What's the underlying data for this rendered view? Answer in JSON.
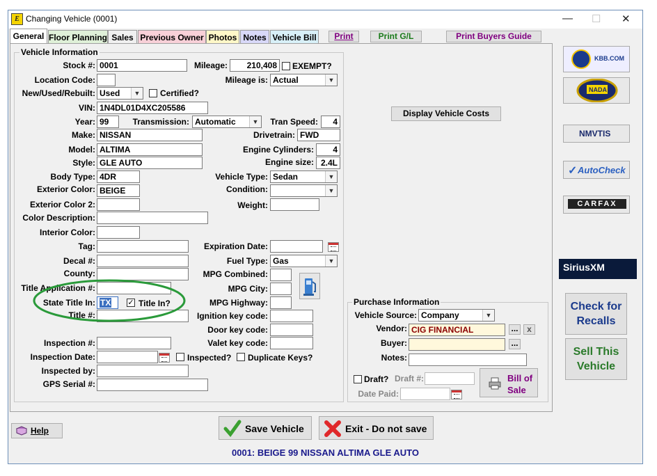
{
  "window": {
    "title": "Changing Vehicle  (0001)",
    "app_icon": "E"
  },
  "tabs": [
    {
      "label": "General",
      "color": "#ffffff"
    },
    {
      "label": "Floor Planning",
      "color": "#dff0d8"
    },
    {
      "label": "Sales",
      "color": "#f0f0f0"
    },
    {
      "label": "Previous Owner",
      "color": "#f8d0d8"
    },
    {
      "label": "Photos",
      "color": "#fff8c8"
    },
    {
      "label": "Notes",
      "color": "#d8d8f8"
    },
    {
      "label": "Vehicle Bill",
      "color": "#d8f0f8"
    }
  ],
  "print_buttons": {
    "print": "Print",
    "print_gl": "Print G/L",
    "print_buyers_guide": "Print Buyers Guide"
  },
  "vehicle_info": {
    "group_title": "Vehicle Information",
    "stock_label": "Stock #:",
    "stock": "0001",
    "mileage_label": "Mileage:",
    "mileage": "210,408",
    "exempt_label": "EXEMPT?",
    "location_label": "Location Code:",
    "location": "",
    "mileage_is_label": "Mileage is:",
    "mileage_is": "Actual",
    "new_used_label": "New/Used/Rebuilt:",
    "new_used": "Used",
    "certified_label": "Certified?",
    "vin_label": "VIN:",
    "vin": "1N4DL01D4XC205586",
    "year_label": "Year:",
    "year": "99",
    "transmission_label": "Transmission:",
    "transmission": "Automatic",
    "tran_speed_label": "Tran Speed:",
    "tran_speed": "4",
    "make_label": "Make:",
    "make": "NISSAN",
    "drivetrain_label": "Drivetrain:",
    "drivetrain": "FWD",
    "model_label": "Model:",
    "model": "ALTIMA",
    "cylinders_label": "Engine Cylinders:",
    "cylinders": "4",
    "style_label": "Style:",
    "style": "GLE AUTO",
    "engine_size_label": "Engine size:",
    "engine_size": "2.4L",
    "body_type_label": "Body Type:",
    "body_type": "4DR",
    "vehicle_type_label": "Vehicle Type:",
    "vehicle_type": "Sedan",
    "ext_color_label": "Exterior Color:",
    "ext_color": "BEIGE",
    "condition_label": "Condition:",
    "condition": "",
    "ext_color2_label": "Exterior Color 2:",
    "ext_color2": "",
    "weight_label": "Weight:",
    "weight": "",
    "color_desc_label": "Color Description:",
    "color_desc": "",
    "int_color_label": "Interior Color:",
    "int_color": "",
    "tag_label": "Tag:",
    "tag": "",
    "expiration_label": "Expiration Date:",
    "expiration": "",
    "decal_label": "Decal #:",
    "decal": "",
    "fuel_type_label": "Fuel Type:",
    "fuel_type": "Gas",
    "county_label": "County:",
    "county": "",
    "mpg_combined_label": "MPG Combined:",
    "mpg_combined": "",
    "title_app_label": "Title Application #:",
    "title_app": "",
    "mpg_city_label": "MPG City:",
    "mpg_city": "",
    "state_title_label": "State Title In:",
    "state_title": "TX",
    "title_in_label": "Title In?",
    "mpg_highway_label": "MPG Highway:",
    "mpg_highway": "",
    "title_no_label": "Title #:",
    "title_no": "",
    "ignition_key_label": "Ignition key code:",
    "ignition_key": "",
    "door_key_label": "Door key code:",
    "door_key": "",
    "inspection_no_label": "Inspection #:",
    "inspection_no": "",
    "valet_key_label": "Valet key code:",
    "valet_key": "",
    "inspection_date_label": "Inspection Date:",
    "inspection_date": "",
    "inspected_label": "Inspected?",
    "duplicate_keys_label": "Duplicate Keys?",
    "inspected_by_label": "Inspected by:",
    "inspected_by": "",
    "gps_label": "GPS Serial #:",
    "gps": ""
  },
  "display_costs_button": "Display Vehicle Costs",
  "purchase": {
    "group_title": "Purchase Information",
    "source_label": "Vehicle Source:",
    "source": "Company",
    "vendor_label": "Vendor:",
    "vendor": "CIG FINANCIAL",
    "buyer_label": "Buyer:",
    "buyer": "",
    "notes_label": "Notes:",
    "notes": "",
    "draft_label": "Draft?",
    "draft_no_label": "Draft #:",
    "draft_no": "",
    "date_paid_label": "Date Paid:",
    "date_paid": "",
    "bill_of_sale": "Bill of Sale",
    "ellipsis": "...",
    "clear": "x"
  },
  "side_logos": [
    {
      "name": "kbb",
      "text": "KBB.COM"
    },
    {
      "name": "nada",
      "text": "NADA"
    },
    {
      "name": "nmvtis",
      "text": "NMVTIS"
    },
    {
      "name": "autocheck",
      "text": "AutoCheck"
    },
    {
      "name": "carfax",
      "text": "CARFAX"
    },
    {
      "name": "siriusxm",
      "text": "SiriusXM"
    }
  ],
  "side_buttons": {
    "recalls": "Check for Recalls",
    "sell": "Sell This Vehicle"
  },
  "footer": {
    "help": "Help",
    "save": "Save Vehicle",
    "exit": "Exit - Do not save",
    "status": "0001: BEIGE 99 NISSAN ALTIMA GLE AUTO"
  },
  "colors": {
    "status_text": "#1a1a8c",
    "recalls_text": "#1a3a8c",
    "sell_text": "#2a7a2a",
    "print_text": "#800080",
    "print_gl_text": "#1a7a1a",
    "bill_text": "#800080",
    "vendor_bg": "#fff8dc",
    "annotation": "#2a9a3a"
  }
}
